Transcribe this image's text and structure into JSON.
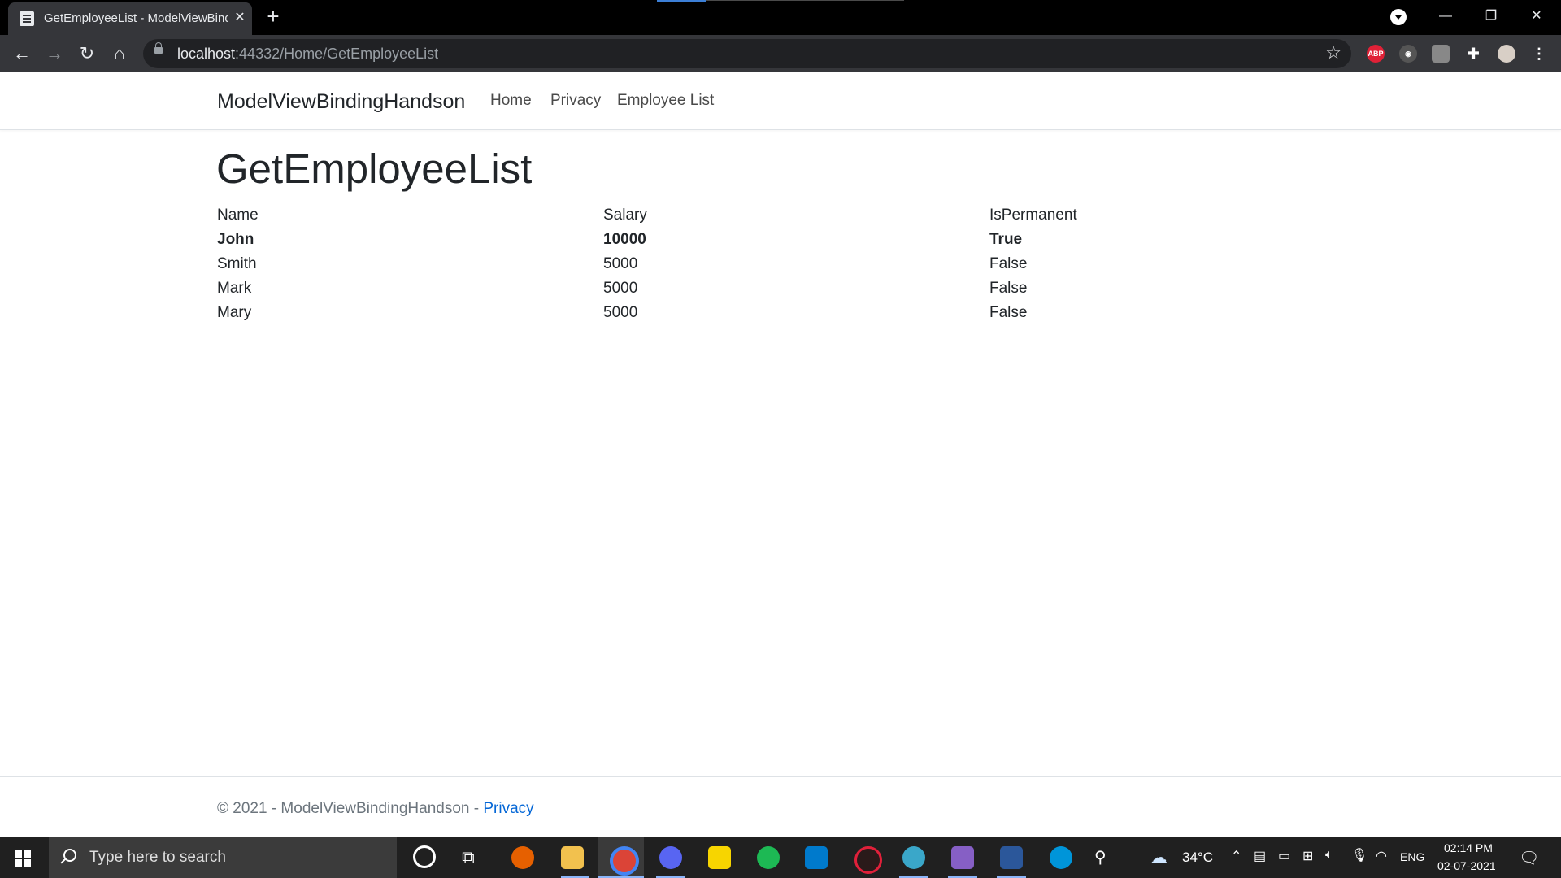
{
  "browser": {
    "tab_title": "GetEmployeeList - ModelViewBinding",
    "url_host": "localhost",
    "url_path": ":44332/Home/GetEmployeeList"
  },
  "site": {
    "brand": "ModelViewBindingHandson",
    "nav": [
      "Home",
      "Privacy",
      "Employee List"
    ]
  },
  "page": {
    "title": "GetEmployeeList",
    "columns": [
      "Name",
      "Salary",
      "IsPermanent"
    ],
    "rows": [
      {
        "name": "John",
        "salary": "10000",
        "permanent": "True"
      },
      {
        "name": "Smith",
        "salary": "5000",
        "permanent": "False"
      },
      {
        "name": "Mark",
        "salary": "5000",
        "permanent": "False"
      },
      {
        "name": "Mary",
        "salary": "5000",
        "permanent": "False"
      }
    ]
  },
  "footer": {
    "text": "© 2021 - ModelViewBindingHandson -",
    "link": "Privacy"
  },
  "taskbar": {
    "search_placeholder": "Type here to search",
    "weather": "34°C",
    "lang": "ENG",
    "time": "02:14 PM",
    "date": "02-07-2021"
  },
  "colors": {
    "link": "#0366d6",
    "text": "#212529",
    "abp": "#e02137"
  }
}
